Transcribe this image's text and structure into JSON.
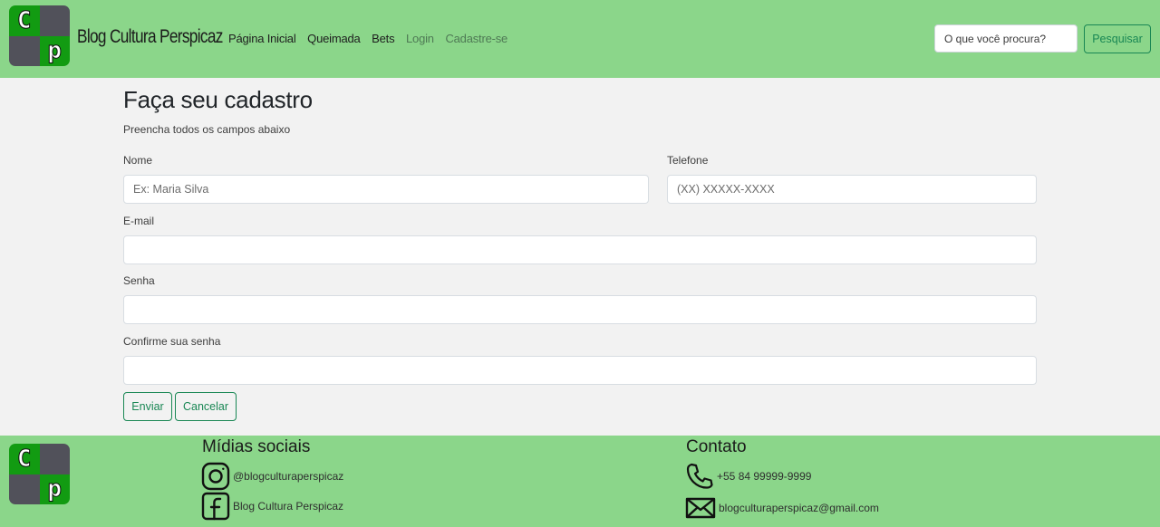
{
  "header": {
    "logo": {
      "top_letter": "C",
      "bottom_letter": "p"
    },
    "brand": "Blog Cultura Perspicaz",
    "nav": [
      {
        "label": "Página Inicial",
        "style": "dark"
      },
      {
        "label": "Queimada",
        "style": "dark"
      },
      {
        "label": "Bets",
        "style": "dark"
      },
      {
        "label": "Login",
        "style": "muted"
      },
      {
        "label": "Cadastre-se",
        "style": "muted"
      }
    ],
    "search": {
      "placeholder": "O que você procura?",
      "button_label": "Pesquisar"
    }
  },
  "form": {
    "title": "Faça seu cadastro",
    "subtitle": "Preencha todos os campos abaixo",
    "name": {
      "label": "Nome",
      "placeholder": "Ex: Maria Silva",
      "value": ""
    },
    "phone": {
      "label": "Telefone",
      "placeholder": "(XX) XXXXX-XXXX",
      "value": ""
    },
    "email": {
      "label": "E-mail",
      "placeholder": "",
      "value": ""
    },
    "password": {
      "label": "Senha",
      "placeholder": "",
      "value": ""
    },
    "confirm_password": {
      "label": "Confirme sua senha",
      "placeholder": "",
      "value": ""
    },
    "submit_label": "Enviar",
    "cancel_label": "Cancelar"
  },
  "footer": {
    "social": {
      "title": "Mídias sociais",
      "instagram": {
        "icon": "instagram-icon",
        "text": "@blogculturaperspicaz"
      },
      "facebook": {
        "icon": "facebook-icon",
        "text": "Blog Cultura Perspicaz"
      }
    },
    "contact": {
      "title": "Contato",
      "phone": {
        "icon": "phone-icon",
        "text": "+55 84 99999-9999"
      },
      "email": {
        "icon": "envelope-icon",
        "text": "blogculturaperspicaz@gmail.com"
      }
    }
  },
  "colors": {
    "header_bg": "#8bd68a",
    "page_bg": "#f2f2f2",
    "accent": "#198754",
    "logo_dark": "#51515a",
    "logo_green": "#129b12"
  }
}
